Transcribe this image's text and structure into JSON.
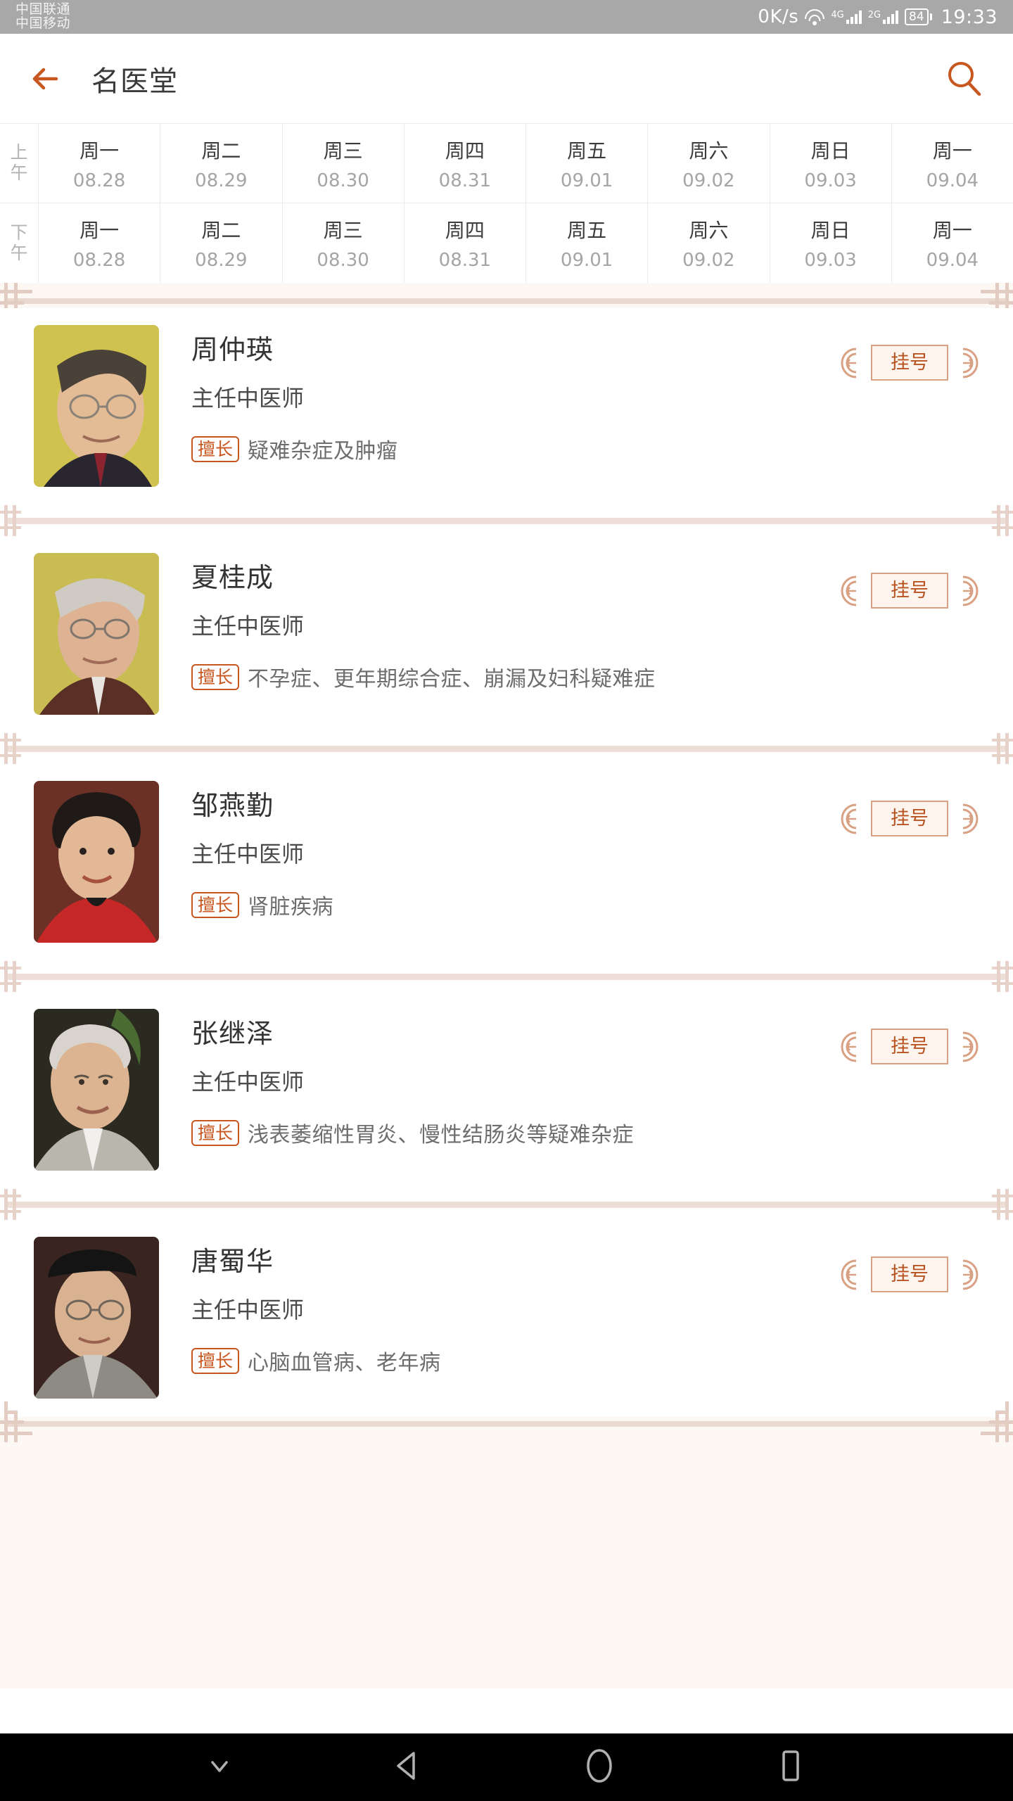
{
  "statusbar": {
    "carrier_1": "中国联通",
    "carrier_2": "中国移动",
    "net_speed": "0K/s",
    "wifi_icon": "wifi-icon",
    "sim1_type": "4G",
    "sim2_type": "2G",
    "battery_level": "84",
    "time": "19:33"
  },
  "header": {
    "back_icon": "back-arrow-icon",
    "title": "名医堂",
    "search_icon": "search-icon"
  },
  "schedule": {
    "rows": [
      {
        "period": "上午",
        "period_chars": [
          "上",
          "午"
        ],
        "days": [
          {
            "day": "周一",
            "date": "08.28"
          },
          {
            "day": "周二",
            "date": "08.29"
          },
          {
            "day": "周三",
            "date": "08.30"
          },
          {
            "day": "周四",
            "date": "08.31"
          },
          {
            "day": "周五",
            "date": "09.01"
          },
          {
            "day": "周六",
            "date": "09.02"
          },
          {
            "day": "周日",
            "date": "09.03"
          },
          {
            "day": "周一",
            "date": "09.04"
          }
        ]
      },
      {
        "period": "下午",
        "period_chars": [
          "下",
          "午"
        ],
        "days": [
          {
            "day": "周一",
            "date": "08.28"
          },
          {
            "day": "周二",
            "date": "08.29"
          },
          {
            "day": "周三",
            "date": "08.30"
          },
          {
            "day": "周四",
            "date": "08.31"
          },
          {
            "day": "周五",
            "date": "09.01"
          },
          {
            "day": "周六",
            "date": "09.02"
          },
          {
            "day": "周日",
            "date": "09.03"
          },
          {
            "day": "周一",
            "date": "09.04"
          }
        ]
      }
    ]
  },
  "doctors": [
    {
      "name": "周仲瑛",
      "title": "主任中医师",
      "specialty_label": "擅长",
      "specialty": "疑难杂症及肿瘤",
      "register_label": "挂号",
      "avatar_bg": "#cfc24e",
      "avatar_name": "doctor-photo-zhou-zhongying"
    },
    {
      "name": "夏桂成",
      "title": "主任中医师",
      "specialty_label": "擅长",
      "specialty": "不孕症、更年期综合症、崩漏及妇科疑难症",
      "register_label": "挂号",
      "avatar_bg": "#c8bc52",
      "avatar_name": "doctor-photo-xia-guicheng"
    },
    {
      "name": "邹燕勤",
      "title": "主任中医师",
      "specialty_label": "擅长",
      "specialty": "肾脏疾病",
      "register_label": "挂号",
      "avatar_bg": "#6b3026",
      "avatar_name": "doctor-photo-zou-yanqin"
    },
    {
      "name": "张继泽",
      "title": "主任中医师",
      "specialty_label": "擅长",
      "specialty": "浅表萎缩性胃炎、慢性结肠炎等疑难杂症",
      "register_label": "挂号",
      "avatar_bg": "#2b2a20",
      "avatar_name": "doctor-photo-zhang-jize"
    },
    {
      "name": "唐蜀华",
      "title": "主任中医师",
      "specialty_label": "擅长",
      "specialty": "心脑血管病、老年病",
      "register_label": "挂号",
      "avatar_bg": "#3a2420",
      "avatar_name": "doctor-photo-tang-shuhua"
    }
  ],
  "navbar": {
    "hide_icon": "chevron-down-icon",
    "back_icon": "triangle-back-icon",
    "home_icon": "circle-home-icon",
    "recents_icon": "square-recents-icon"
  },
  "colors": {
    "accent": "#c8561f",
    "frame": "#e9d9d0",
    "statusbar_bg": "#a8a8a8",
    "page_bg": "#ffffff"
  }
}
